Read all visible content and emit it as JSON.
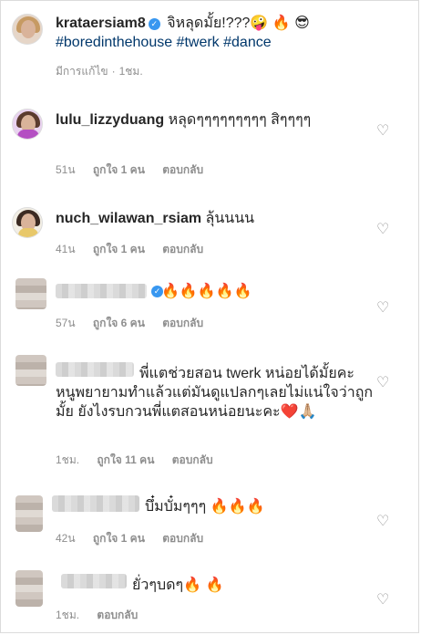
{
  "caption": {
    "username": "krataersiam8",
    "text": "จิหลุดมั้ย!???🤪 🔥 😎",
    "hashtags": "#boredinthehouse #twerk #dance",
    "edited": "มีการแก้ไข",
    "time": "1ชม."
  },
  "comments": [
    {
      "username": "lulu_lizzyduang",
      "text": "หลุดๆๆๆๆๆๆๆๆๆ สิๆๆๆๆ",
      "time": "51น",
      "likes": "ถูกใจ 1 คน",
      "reply": "ตอบกลับ"
    },
    {
      "username": "nuch_wilawan_rsiam",
      "text": "ลุ้นนนน",
      "time": "41น",
      "likes": "ถูกใจ 1 คน",
      "reply": "ตอบกลับ"
    },
    {
      "username": "",
      "text": "🔥🔥🔥🔥🔥",
      "time": "57น",
      "likes": "ถูกใจ 6 คน",
      "reply": "ตอบกลับ"
    },
    {
      "username": "",
      "text": "พี่แตช่วยสอน twerk หน่อยได้มั้ยคะ หนูพยายามทำแล้วแต่มันดูแปลกๆเลยไม่แน่ใจว่าถูกมั้ย ยังไงรบกวนพี่แตสอนหน่อยนะคะ❤️🙏🏼",
      "time": "1ชม.",
      "likes": "ถูกใจ 11 คน",
      "reply": "ตอบกลับ"
    },
    {
      "username": "",
      "text": "บึ๋มบั๋มๆๆๆ 🔥🔥🔥",
      "time": "42น",
      "likes": "ถูกใจ 1 คน",
      "reply": "ตอบกลับ"
    },
    {
      "username": "",
      "text": "ยั่วๆบดๆ🔥 🔥",
      "time": "1ชม.",
      "likes": "",
      "reply": "ตอบกลับ"
    }
  ],
  "icons": {
    "heart": "heart-outline-icon",
    "verified": "verified-badge-icon"
  }
}
